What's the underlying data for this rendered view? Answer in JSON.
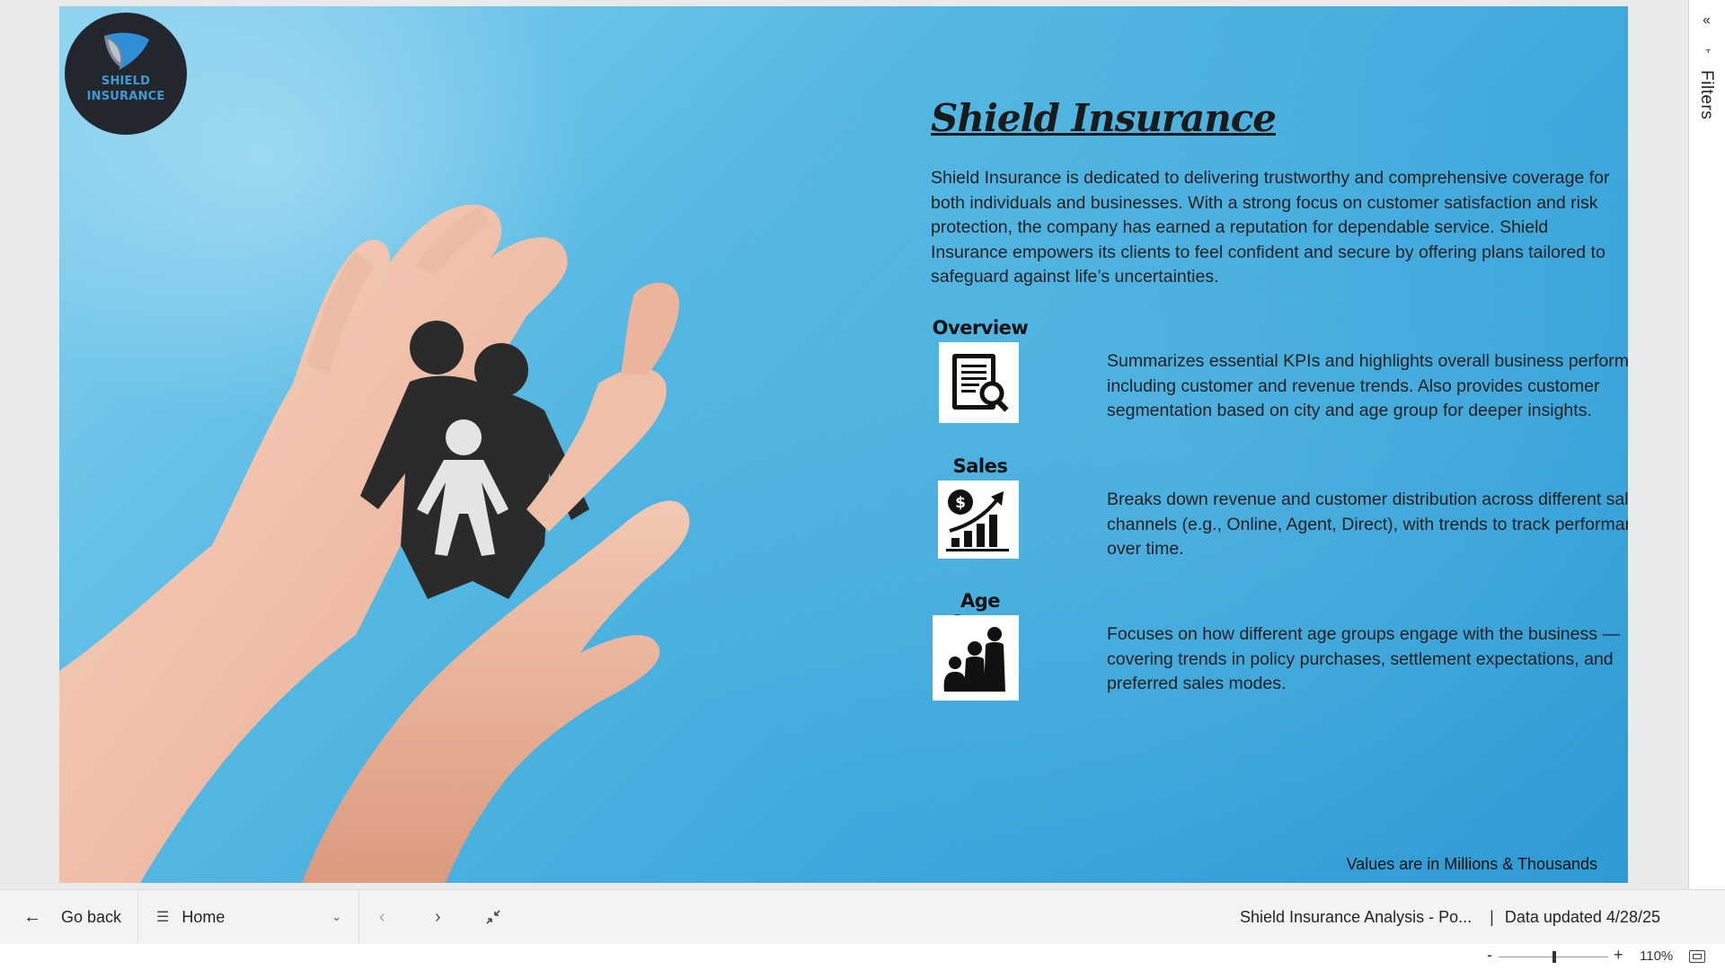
{
  "logo": {
    "line1": "SHIELD",
    "line2": "INSURANCE"
  },
  "hero_image": {
    "subject": "hands-holding-paper-family"
  },
  "content": {
    "title": "Shield Insurance",
    "intro": "Shield Insurance is dedicated to delivering trustworthy and comprehensive coverage for both individuals and businesses. With a strong focus on customer satisfaction and risk protection, the company has earned a reputation for dependable service. Shield Insurance empowers its clients to feel confident and secure by offering plans tailored to safeguard against life’s uncertainties.",
    "sections": [
      {
        "heading": "Overview",
        "icon": "document-search-icon",
        "description": "Summarizes essential KPIs and highlights overall business performance, including customer and revenue trends. Also provides customer segmentation based on city and age group for deeper insights."
      },
      {
        "heading": "Sales",
        "icon": "sales-growth-chart-icon",
        "description": "Breaks down revenue and customer distribution across different sales channels (e.g., Online, Agent, Direct), with trends to track performance over time."
      },
      {
        "heading": "Age Group",
        "icon": "family-group-icon",
        "description": "Focuses on how different age groups engage with the business — covering trends in policy purchases, settlement expectations, and preferred sales modes."
      }
    ],
    "note": "Values are in Millions & Thousands"
  },
  "filters_pane": {
    "label": "Filters"
  },
  "bottom_bar": {
    "back_label": "Go back",
    "page_select": "Home",
    "report_name": "Shield Insurance Analysis - Po...",
    "data_updated": "Data updated 4/28/25"
  },
  "zoom": {
    "minus": "-",
    "plus": "+",
    "level": "110%",
    "slider_fraction": 0.5
  },
  "colors": {
    "accent": "#3d9bd8",
    "background": "#3fa9dc",
    "logo_bg": "#23262d"
  }
}
